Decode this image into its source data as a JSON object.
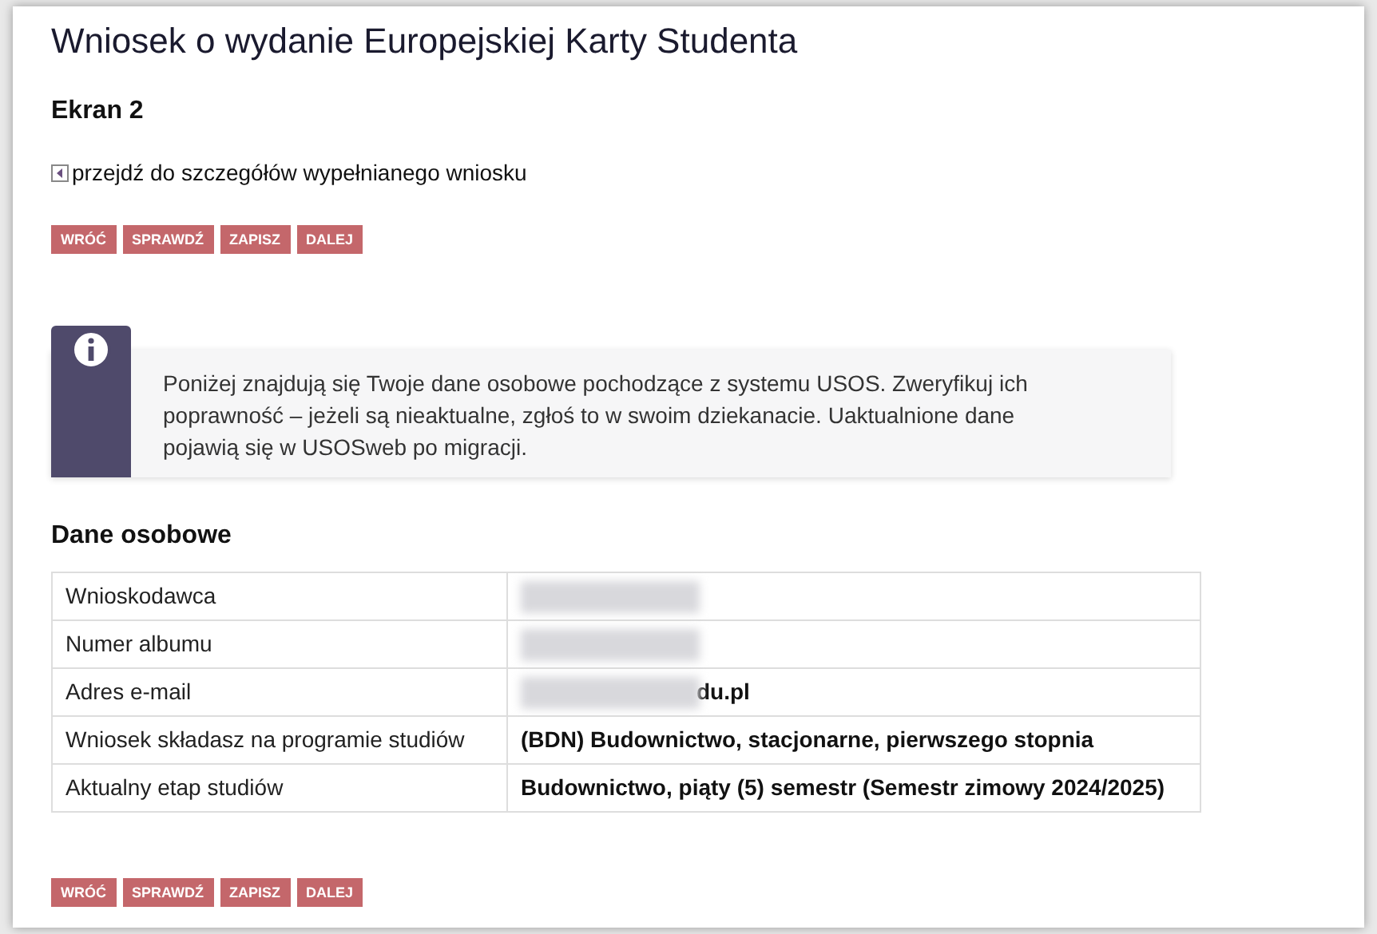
{
  "title": "Wniosek o wydanie Europejskiej Karty Studenta",
  "subtitle": "Ekran 2",
  "details_link": "przejdź do szczegółów wypełnianego wniosku",
  "buttons_top": [
    "WRÓĆ",
    "SPRAWDŹ",
    "ZAPISZ",
    "DALEJ"
  ],
  "info": "Poniżej znajdują się Twoje dane osobowe pochodzące z systemu USOS. Zweryfikuj ich poprawność – jeżeli są nieaktualne, zgłoś to w swoim dziekanacie. Uaktualnione dane pojawią się w USOSweb po migracji.",
  "section": "Dane osobowe",
  "rows": [
    {
      "label": "Wnioskodawca",
      "redacted": true
    },
    {
      "label": "Numer albumu",
      "redacted": true
    },
    {
      "label": "Adres e-mail",
      "redacted": true,
      "value": "du.pl"
    },
    {
      "label": "Wniosek składasz na programie studiów",
      "redacted": false,
      "value": "(BDN) Budownictwo, stacjonarne, pierwszego stopnia"
    },
    {
      "label": "Aktualny etap studiów",
      "redacted": false,
      "value": "Budownictwo, piąty (5) semestr (Semestr zimowy 2024/2025)"
    }
  ],
  "buttons_bottom": [
    "WRÓĆ",
    "SPRAWDŹ",
    "ZAPISZ",
    "DALEJ"
  ]
}
